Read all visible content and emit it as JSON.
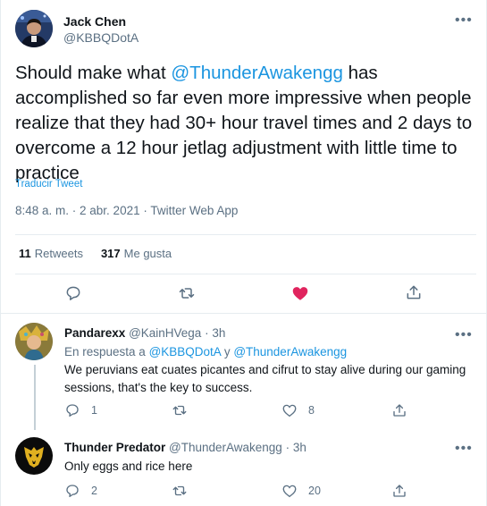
{
  "main_tweet": {
    "author_name": "Jack Chen",
    "author_handle": "@KBBQDotA",
    "text_before_mention": "Should make what ",
    "mention": "@ThunderAwakengg",
    "text_after_mention": " has accomplished so far even more impressive when people realize that they had 30+ hour travel times and 2 days to overcome a 12 hour jetlag adjustment with little time to practice",
    "translate_label": "Traducir Tweet",
    "timestamp": "8:48 a. m. · 2 abr. 2021 · Twitter Web App",
    "retweets_count": "11",
    "retweets_label": "Retweets",
    "likes_count": "317",
    "likes_label": "Me gusta",
    "liked": true,
    "like_color": "#e0245e",
    "icons": [
      "reply-icon",
      "retweet-icon",
      "like-icon",
      "share-icon"
    ]
  },
  "replies": [
    {
      "author_name": "Pandarexx",
      "author_handle": "@KainHVega",
      "time": "· 3h",
      "in_reply_prefix": "En respuesta a ",
      "in_reply_user1": "@KBBQDotA",
      "in_reply_joiner": " y ",
      "in_reply_user2": "@ThunderAwakengg",
      "text": "We peruvians eat cuates picantes and cifrut to stay alive during our gaming sessions, that's the key to success.",
      "reply_count": "1",
      "retweet_count": "",
      "like_count": "8"
    },
    {
      "author_name": "Thunder Predator",
      "author_handle": "@ThunderAwakengg",
      "time": "· 3h",
      "text": "Only eggs and rice here",
      "reply_count": "2",
      "retweet_count": "",
      "like_count": "20"
    }
  ],
  "colors": {
    "link": "#1b95e0",
    "secondary_text": "#5b7083",
    "like_active": "#e0245e",
    "divider": "#e6ecf0"
  }
}
